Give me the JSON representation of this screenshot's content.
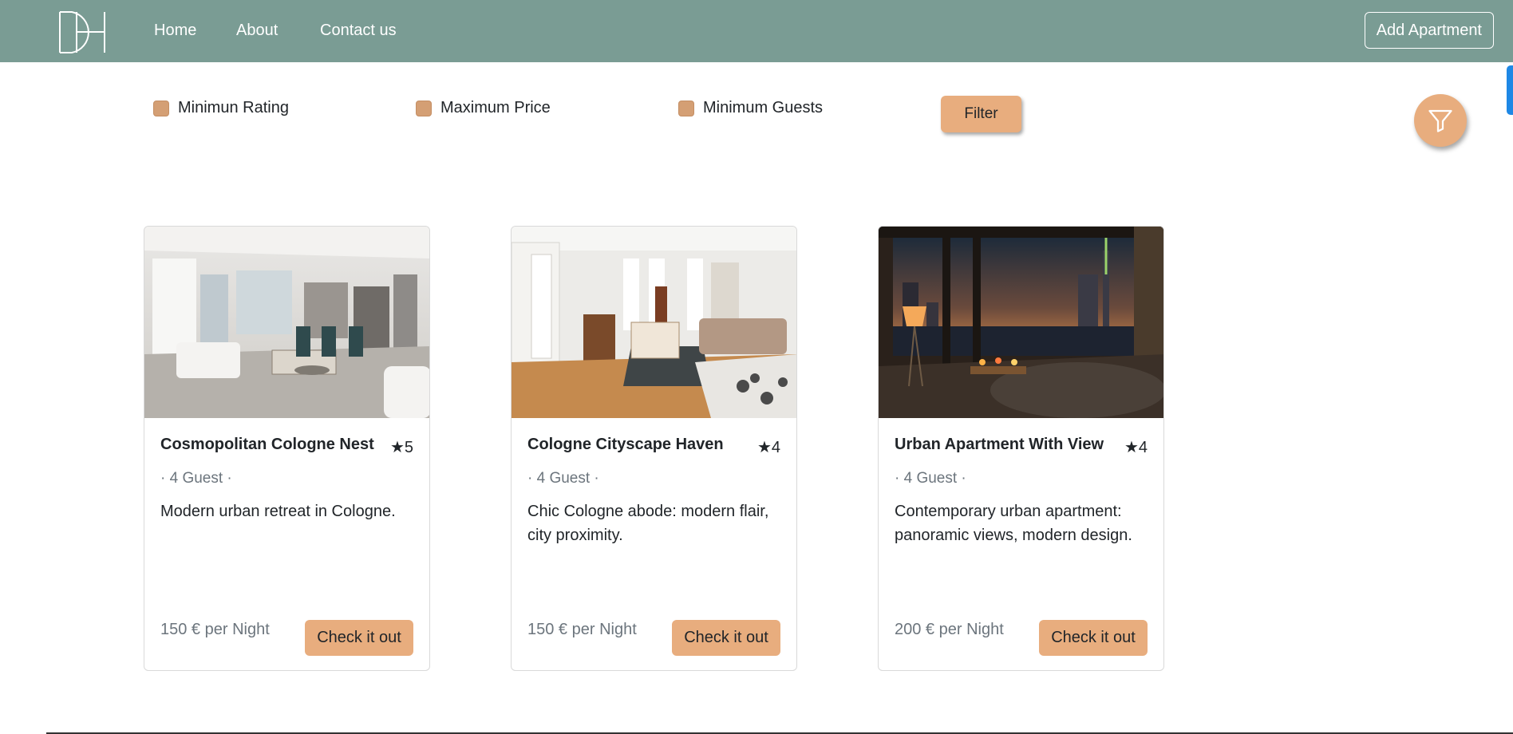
{
  "nav": {
    "links": [
      "Home",
      "About",
      "Contact us"
    ],
    "add_button": "Add Apartment",
    "logo_icon": "dh-monogram-logo"
  },
  "filters": {
    "checks": [
      "Minimun Rating",
      "Maximum Price",
      "Minimum Guests"
    ],
    "filter_button": "Filter",
    "fab_icon": "funnel-icon"
  },
  "cards": [
    {
      "title": "Cosmopolitan Cologne Nest",
      "rating": "★5",
      "guests": "· 4 Guest ·",
      "description": "Modern urban retreat in Cologne.",
      "price": "150 € per Night",
      "button": "Check it out",
      "image": "bright-open-plan-living-kitchen"
    },
    {
      "title": "Cologne Cityscape Haven",
      "rating": "★4",
      "guests": "· 4 Guest ·",
      "description": "Chic Cologne abode: modern flair, city proximity.",
      "price": "150 € per Night",
      "button": "Check it out",
      "image": "parquet-living-dining-room"
    },
    {
      "title": "Urban Apartment With View",
      "rating": "★4",
      "guests": "· 4 Guest ·",
      "description": "Contemporary urban apartment: panoramic views, modern design.",
      "price": "200 € per Night",
      "button": "Check it out",
      "image": "night-skyline-bedroom-view"
    }
  ],
  "colors": {
    "navbar": "#7a9c94",
    "accent": "#e8ad7e",
    "checkbox": "#d49f74",
    "muted_text": "#6c757d"
  }
}
